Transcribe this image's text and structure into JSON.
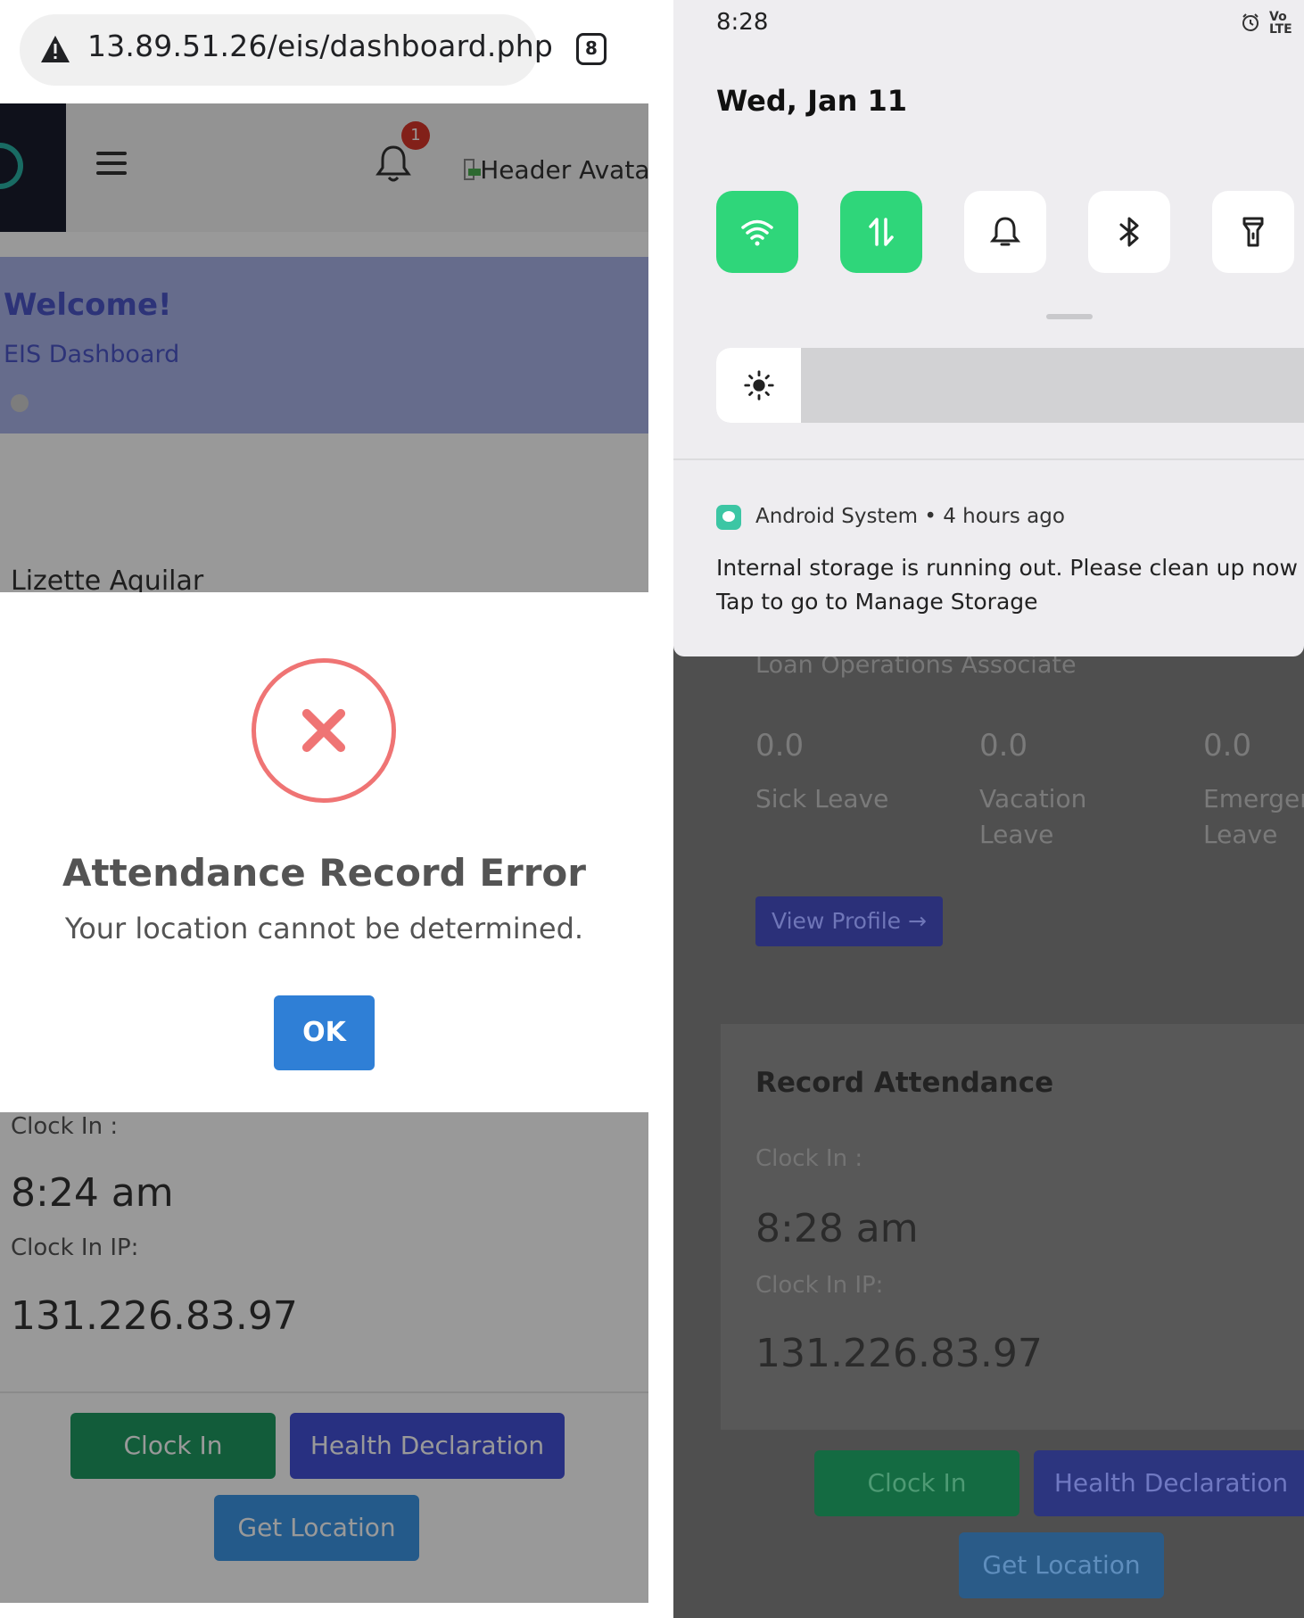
{
  "left": {
    "browser": {
      "url": "13.89.51.26/eis/dashboard.php",
      "tab_count": "8"
    },
    "header": {
      "notification_count": "1",
      "avatar_alt": "Header Avatar"
    },
    "welcome": {
      "title": "Welcome!",
      "subtitle": "EIS Dashboard"
    },
    "user": {
      "name": "Lizette Aquilar"
    },
    "dialog": {
      "title": "Attendance Record Error",
      "message": "Your location cannot be determined.",
      "ok_label": "OK"
    },
    "attendance": {
      "clock_in_label": "Clock In :",
      "clock_in_time": "8:24 am",
      "ip_label": "Clock In IP:",
      "ip_value": "131.226.83.97"
    },
    "buttons": {
      "clock_in": "Clock In",
      "health": "Health Declaration",
      "get_location": "Get Location"
    }
  },
  "right": {
    "status_bar": {
      "time": "8:28",
      "volte": "Vo LTE"
    },
    "quick_settings": {
      "date": "Wed, Jan 11",
      "tiles": [
        {
          "icon": "wifi-icon",
          "on": true
        },
        {
          "icon": "mobile-data-icon",
          "on": true
        },
        {
          "icon": "bell-icon",
          "on": false
        },
        {
          "icon": "bluetooth-icon",
          "on": false
        },
        {
          "icon": "flashlight-icon",
          "on": false
        }
      ],
      "brightness_level": 0.14
    },
    "notification": {
      "app": "Android System",
      "time": "4 hours ago",
      "line1": "Internal storage is running out. Please clean up now",
      "line2": "Tap to go to Manage Storage"
    },
    "profile": {
      "title": "Loan Operations Associate",
      "stats": [
        {
          "value": "0.0",
          "label": "Sick Leave"
        },
        {
          "value": "0.0",
          "label": "Vacation Leave"
        },
        {
          "value": "0.0",
          "label": "Emergen Leave"
        }
      ],
      "view_profile": "View Profile →"
    },
    "attendance": {
      "title": "Record Attendance",
      "clock_in_label": "Clock In :",
      "clock_in_time": "8:28 am",
      "ip_label": "Clock In IP:",
      "ip_value": "131.226.83.97"
    },
    "buttons": {
      "clock_in": "Clock In",
      "health": "Health Declaration",
      "get_location": "Get Location"
    }
  },
  "colors": {
    "accent_blue": "#2f7fd6",
    "error_red": "#ef7474",
    "green_button": "#1f9a62",
    "indigo_button": "#4350d8",
    "qs_active": "#2fd67a"
  }
}
